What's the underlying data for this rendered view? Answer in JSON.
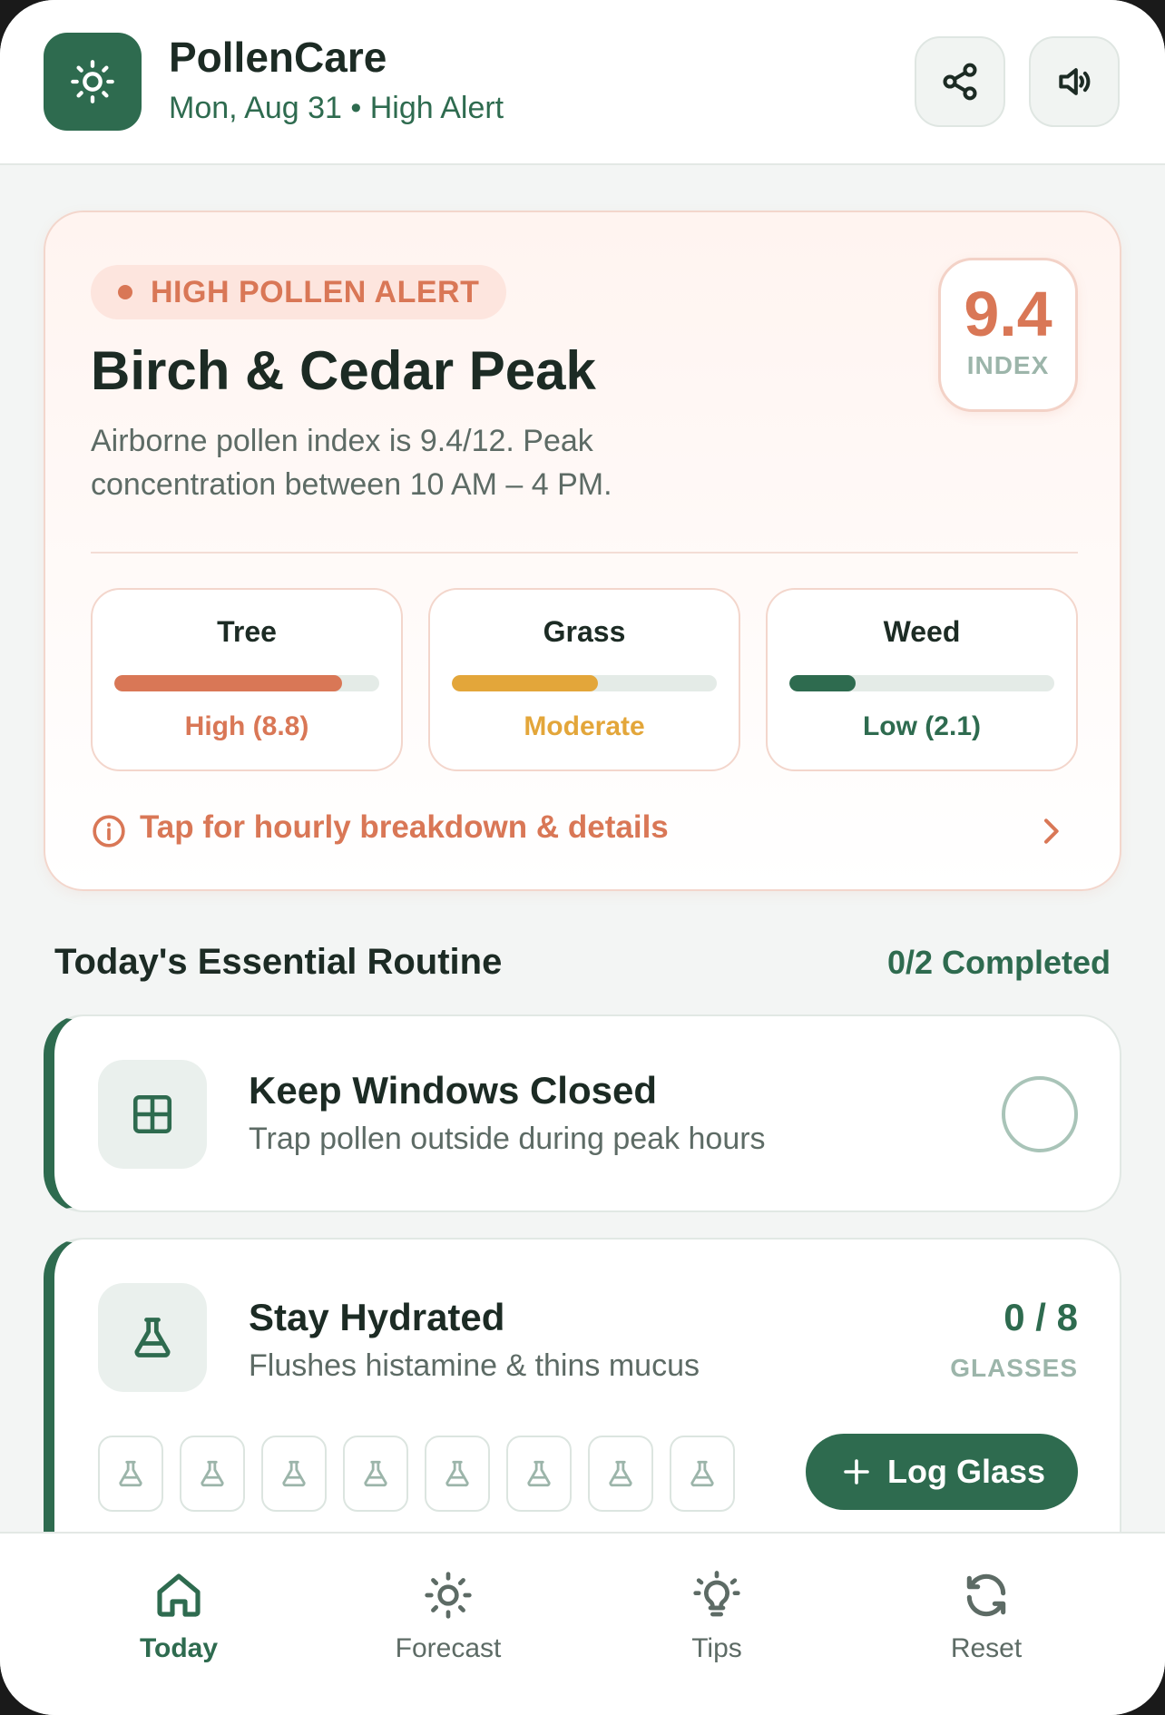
{
  "app": {
    "title": "PollenCare",
    "subtitle": "Mon, Aug 31 • High Alert",
    "logo_icon": "sun-icon"
  },
  "header_actions": [
    {
      "name": "share",
      "icon": "share-icon"
    },
    {
      "name": "audio",
      "icon": "speaker-icon"
    }
  ],
  "alert": {
    "badge": "HIGH POLLEN ALERT",
    "title": "Birch & Cedar Peak",
    "description": "Airborne pollen index is 9.4/12. Peak concentration between 10 AM – 4 PM.",
    "index_value": "9.4",
    "index_label": "INDEX",
    "accent_color": "#d97756",
    "pollen_types": [
      {
        "name": "Tree",
        "level": "High (8.8)",
        "fill": 0.86,
        "color": "#d97756"
      },
      {
        "name": "Grass",
        "level": "Moderate",
        "fill": 0.55,
        "color": "#e3a63a"
      },
      {
        "name": "Weed",
        "level": "Low (2.1)",
        "fill": 0.25,
        "color": "#2e6b4f"
      }
    ],
    "detail_link": "Tap for hourly breakdown & details"
  },
  "routine": {
    "title": "Today's Essential Routine",
    "completed": "0/2 Completed",
    "tasks": [
      {
        "title": "Keep Windows Closed",
        "subtitle": "Trap pollen outside during peak hours",
        "icon": "window-icon",
        "done": false
      },
      {
        "title": "Stay Hydrated",
        "subtitle": "Flushes histamine & thins mucus",
        "icon": "flask-icon",
        "count": "0 / 8",
        "unit": "GLASSES",
        "glasses_total": 8,
        "glasses_logged": 0,
        "button": "Log Glass"
      }
    ]
  },
  "nav": {
    "items": [
      {
        "label": "Today",
        "icon": "home-icon",
        "active": true
      },
      {
        "label": "Forecast",
        "icon": "sun-icon",
        "active": false
      },
      {
        "label": "Tips",
        "icon": "lightbulb-icon",
        "active": false
      },
      {
        "label": "Reset",
        "icon": "refresh-icon",
        "active": false
      }
    ]
  },
  "colors": {
    "primary": "#2e6b4f",
    "alert": "#d97756",
    "moderate": "#e3a63a",
    "background": "#f3f5f4"
  }
}
